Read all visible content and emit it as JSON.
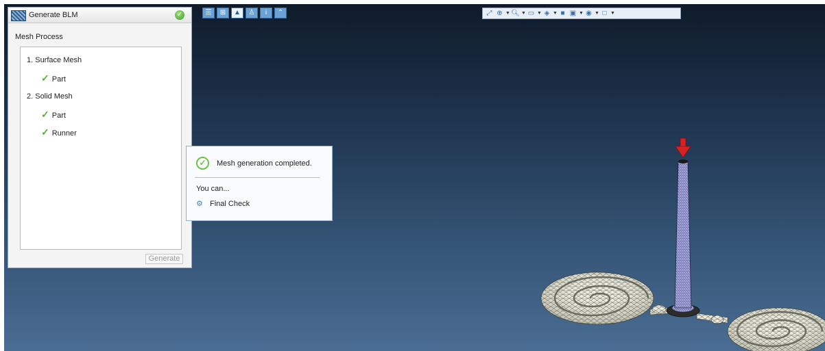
{
  "panel": {
    "title": "Generate BLM",
    "section_label": "Mesh Process",
    "steps": [
      {
        "label": "1. Surface Mesh",
        "children": [
          "Part"
        ]
      },
      {
        "label": "2. Solid Mesh",
        "children": [
          "Part",
          "Runner"
        ]
      }
    ],
    "generate_label": "Generate"
  },
  "left_toolbar": {
    "icons": [
      "list-icon",
      "tree-icon",
      "model-icon",
      "gate-icon",
      "info-icon",
      "collapse-icon"
    ],
    "active_index": 2
  },
  "right_toolbar": {
    "icons": [
      "fit-view-icon",
      "rotate-center-icon",
      "zoom-icon",
      "view-cube-icon",
      "display-mode-icon",
      "plane-icon",
      "all-label-icon",
      "visibility-icon",
      "frame-icon"
    ]
  },
  "notification": {
    "message": "Mesh generation completed.",
    "prompt": "You can...",
    "action_label": "Final Check"
  },
  "colors": {
    "accent": "#5cae2f",
    "viewport_top": "#0f1b2a",
    "viewport_bottom": "#4a6d92",
    "gate_arrow": "#d62222"
  }
}
